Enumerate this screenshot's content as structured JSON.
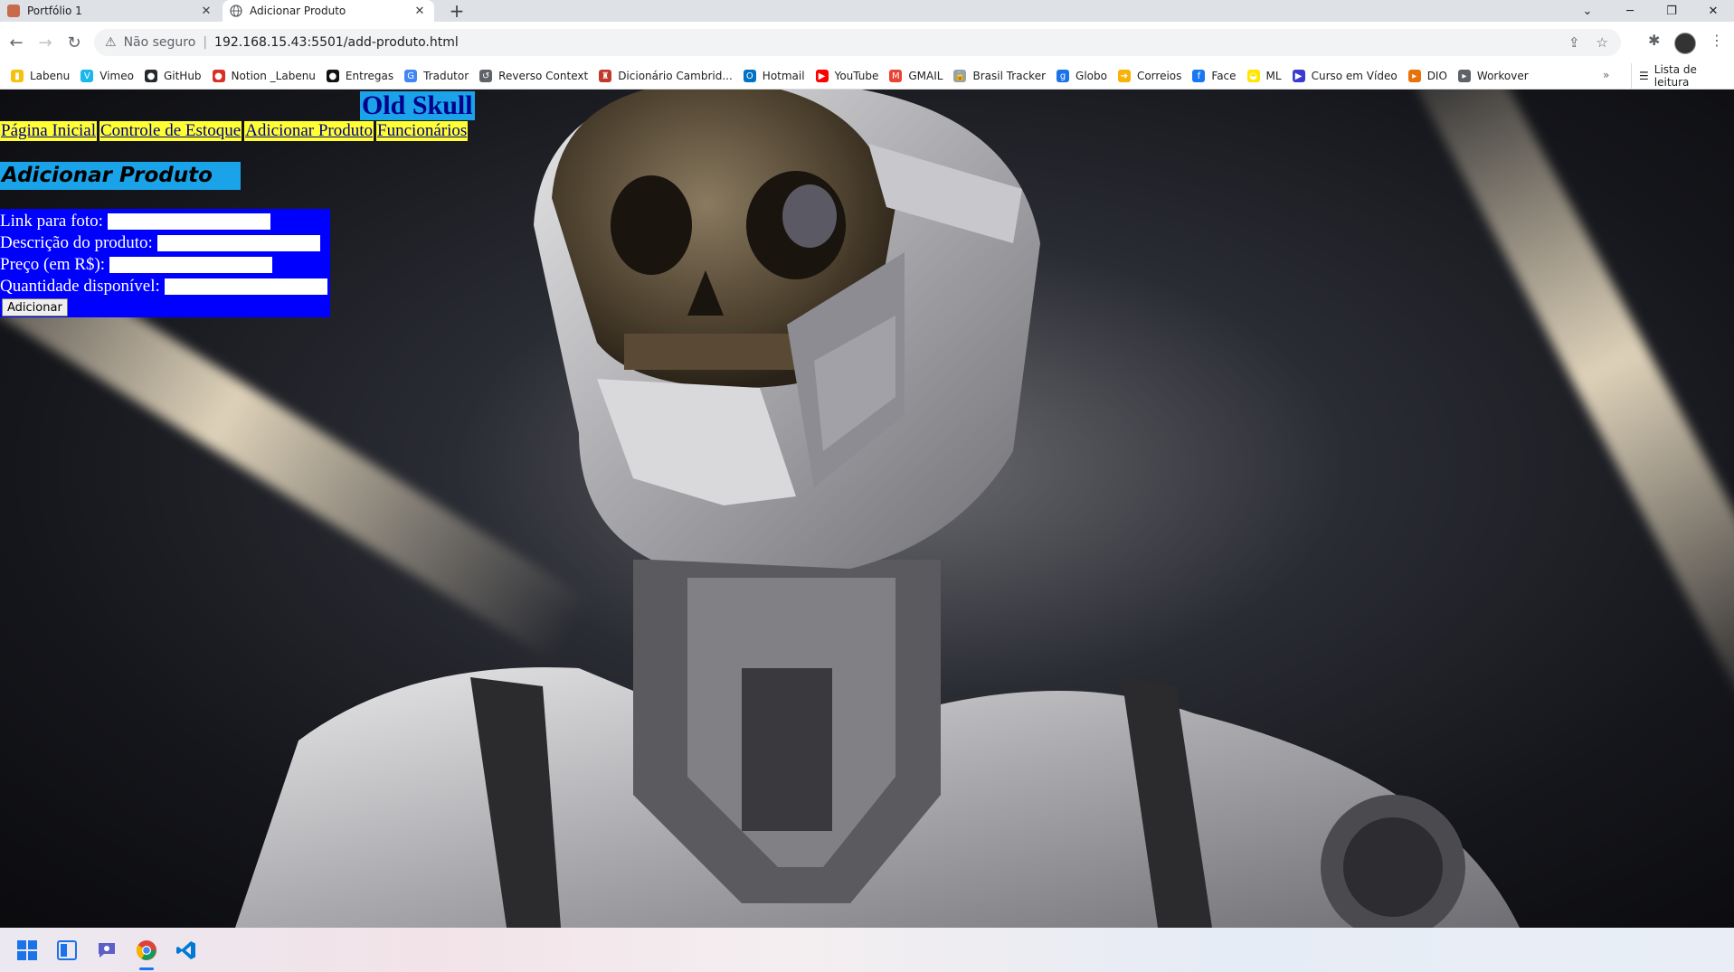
{
  "browser": {
    "tabs": [
      {
        "title": "Portfólio 1",
        "active": false
      },
      {
        "title": "Adicionar Produto",
        "active": true
      }
    ],
    "address": {
      "security_label": "Não seguro",
      "url": "192.168.15.43:5501/add-produto.html"
    },
    "bookmarks": [
      {
        "label": "Labenu",
        "icon": "folder-icon",
        "color": "#f4c20d"
      },
      {
        "label": "Vimeo",
        "icon": "vimeo-icon",
        "color": "#1ab7ea"
      },
      {
        "label": "GitHub",
        "icon": "github-icon",
        "color": "#24292e"
      },
      {
        "label": "Notion _Labenu",
        "icon": "apple-icon",
        "color": "#d93025"
      },
      {
        "label": "Entregas",
        "icon": "circle-icon",
        "color": "#111111"
      },
      {
        "label": "Tradutor",
        "icon": "translate-icon",
        "color": "#4285f4"
      },
      {
        "label": "Reverso Context",
        "icon": "reverso-icon",
        "color": "#5f6368"
      },
      {
        "label": "Dicionário Cambrid...",
        "icon": "cambridge-icon",
        "color": "#c0392b"
      },
      {
        "label": "Hotmail",
        "icon": "outlook-icon",
        "color": "#0072c6"
      },
      {
        "label": "YouTube",
        "icon": "youtube-icon",
        "color": "#ff0000"
      },
      {
        "label": "GMAIL",
        "icon": "gmail-icon",
        "color": "#ea4335"
      },
      {
        "label": "Brasil Tracker",
        "icon": "lock-icon",
        "color": "#9aa0a6"
      },
      {
        "label": "Globo",
        "icon": "globo-icon",
        "color": "#1a73e8"
      },
      {
        "label": "Correios",
        "icon": "correios-icon",
        "color": "#f9b208"
      },
      {
        "label": "Face",
        "icon": "facebook-icon",
        "color": "#1877f2"
      },
      {
        "label": "ML",
        "icon": "mercadolivre-icon",
        "color": "#ffe600"
      },
      {
        "label": "Curso em Vídeo",
        "icon": "cursoemvideo-icon",
        "color": "#3b3bd1"
      },
      {
        "label": "DIO",
        "icon": "dio-icon",
        "color": "#e8710a"
      },
      {
        "label": "Workover",
        "icon": "workover-icon",
        "color": "#5f6368"
      }
    ],
    "reading_list": "Lista de leitura"
  },
  "page": {
    "site_title": "Old Skull",
    "nav": [
      "Página Inicial",
      "Controle de Estoque",
      "Adicionar Produto",
      "Funcionários"
    ],
    "heading": "Adicionar Produto",
    "form": {
      "fields": [
        {
          "label": "Link para foto:",
          "value": ""
        },
        {
          "label": "Descrição do produto:",
          "value": ""
        },
        {
          "label": "Preço (em R$):",
          "value": ""
        },
        {
          "label": "Quantidade disponível:",
          "value": ""
        }
      ],
      "submit_label": "Adicionar"
    },
    "colors": {
      "title_bg": "#1aa3e8",
      "nav_bg": "#ffff33",
      "form_bg": "#0000ff"
    }
  },
  "taskbar": {
    "icons": [
      "windows-start-icon",
      "widgets-icon",
      "teams-chat-icon",
      "chrome-icon",
      "vscode-icon"
    ]
  }
}
